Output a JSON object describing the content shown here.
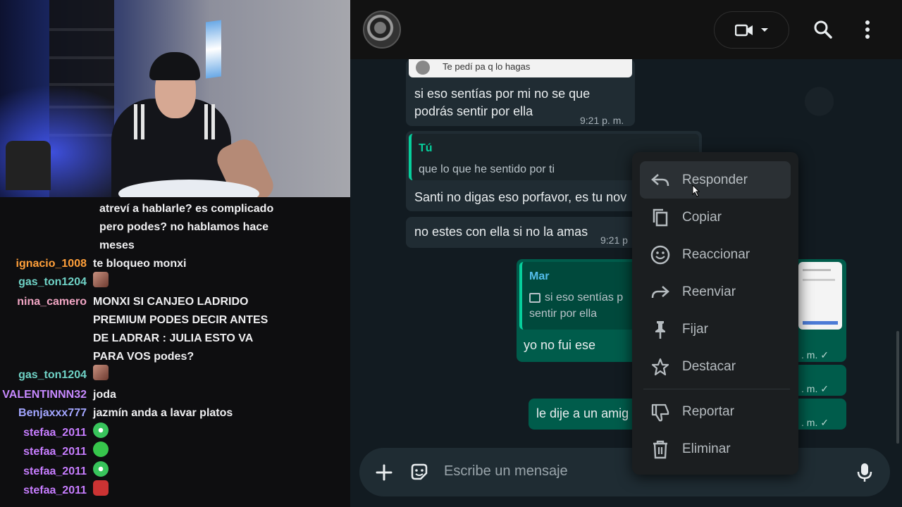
{
  "chat": {
    "lines": [
      {
        "user": "",
        "color": "#efeff1",
        "text": "atreví a hablarle? es complicado pero podes? no hablamos hace meses",
        "cont": true
      },
      {
        "user": "ignacio_1008",
        "color": "#ff9f3a",
        "text": "te bloqueo monxi"
      },
      {
        "user": "gas_ton1204",
        "color": "#6fd2c6",
        "text": "",
        "emote": "face"
      },
      {
        "user": "nina_camero",
        "color": "#f2a6c4",
        "text": "MONXI SI CANJEO LADRIDO PREMIUM PODES DECIR ANTES DE LADRAR : JULIA ESTO VA PARA VOS podes?"
      },
      {
        "user": "gas_ton1204",
        "color": "#6fd2c6",
        "text": "",
        "emote": "face"
      },
      {
        "user": "VALENTINNN32",
        "color": "#c789ff",
        "text": "joda"
      },
      {
        "user": "Benjaxxx777",
        "color": "#a3a6ff",
        "text": "jazmín anda a lavar platos"
      },
      {
        "user": "stefaa_2011",
        "color": "#c77dff",
        "text": "",
        "emote": "alien"
      },
      {
        "user": "stefaa_2011",
        "color": "#c77dff",
        "text": "",
        "emote": "slime"
      },
      {
        "user": "stefaa_2011",
        "color": "#c77dff",
        "text": "",
        "emote": "alien"
      },
      {
        "user": "stefaa_2011",
        "color": "#c77dff",
        "text": "",
        "emote": "red"
      }
    ]
  },
  "whatsapp": {
    "messages": {
      "m1_quote_text": "Te pedí pa q lo hagas",
      "m1_text": "si eso sentías por mi no se que podrás sentir por ella",
      "m1_time": "9:21 p. m.",
      "m2_quote_author": "Tú",
      "m2_quote_text": "que lo que he sentido por ti",
      "m2_text": "Santi no digas eso porfavor, es tu nov",
      "m3_text": "no estes con ella si no la amas",
      "m3_time": "9:21 p",
      "m4_quote_author": "Mar",
      "m4_quote_text": "si eso sentías p",
      "m4_quote_text2": "sentir por ella",
      "m4_text": "yo no fui ese",
      "m4_time": ". m. ✓",
      "m5_time": ". m. ✓",
      "m6_text": "le dije a un amig",
      "m6_time": ". m. ✓"
    },
    "composer": {
      "placeholder": "Escribe un mensaje"
    },
    "context_menu": [
      {
        "label": "Responder",
        "icon": "reply-icon"
      },
      {
        "label": "Copiar",
        "icon": "copy-icon"
      },
      {
        "label": "Reaccionar",
        "icon": "emoji-icon"
      },
      {
        "label": "Reenviar",
        "icon": "forward-icon"
      },
      {
        "label": "Fijar",
        "icon": "pin-icon"
      },
      {
        "label": "Destacar",
        "icon": "star-icon"
      },
      {
        "label": "Reportar",
        "icon": "report-icon"
      },
      {
        "label": "Eliminar",
        "icon": "trash-icon"
      }
    ]
  },
  "colors": {
    "accent": "#06cf9c",
    "outgoing": "#005c4b",
    "incoming": "#202c33"
  }
}
